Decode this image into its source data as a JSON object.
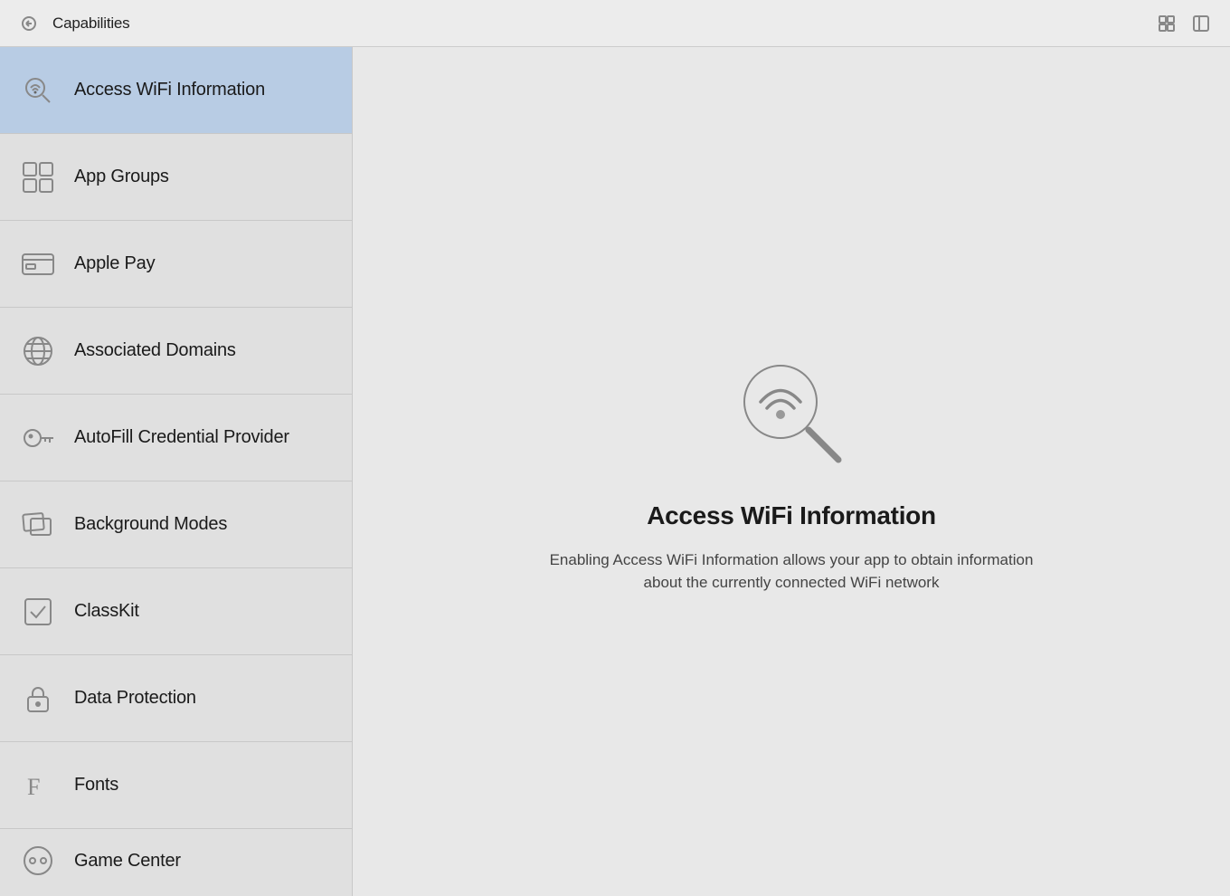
{
  "titlebar": {
    "title": "Capabilities",
    "grid_icon": "grid-icon",
    "window_icon": "window-icon"
  },
  "sidebar": {
    "items": [
      {
        "id": "access-wifi",
        "label": "Access WiFi Information",
        "icon": "wifi-search-icon",
        "active": true
      },
      {
        "id": "app-groups",
        "label": "App Groups",
        "icon": "app-groups-icon",
        "active": false
      },
      {
        "id": "apple-pay",
        "label": "Apple Pay",
        "icon": "apple-pay-icon",
        "active": false
      },
      {
        "id": "associated-domains",
        "label": "Associated Domains",
        "icon": "globe-icon",
        "active": false
      },
      {
        "id": "autofill",
        "label": "AutoFill Credential Provider",
        "icon": "key-icon",
        "active": false
      },
      {
        "id": "background-modes",
        "label": "Background Modes",
        "icon": "background-modes-icon",
        "active": false
      },
      {
        "id": "classkit",
        "label": "ClassKit",
        "icon": "classkit-icon",
        "active": false
      },
      {
        "id": "data-protection",
        "label": "Data Protection",
        "icon": "lock-icon",
        "active": false
      },
      {
        "id": "fonts",
        "label": "Fonts",
        "icon": "fonts-icon",
        "active": false
      },
      {
        "id": "game-center",
        "label": "Game Center",
        "icon": "game-center-icon",
        "active": false
      }
    ]
  },
  "detail": {
    "title": "Access WiFi Information",
    "description": "Enabling Access WiFi Information allows your app to obtain information about the currently connected WiFi network"
  }
}
